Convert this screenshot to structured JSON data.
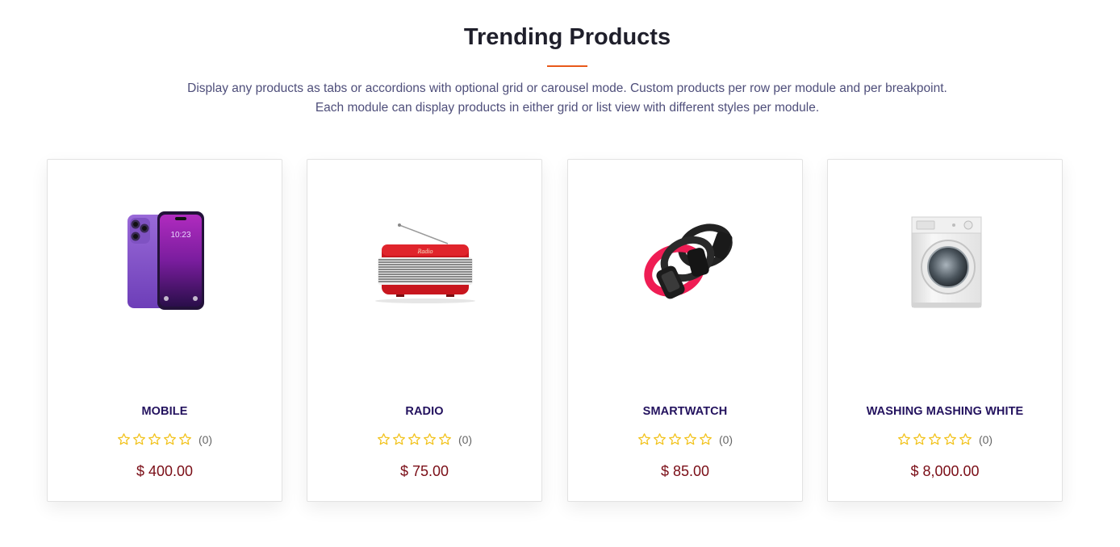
{
  "section": {
    "title": "Trending Products",
    "description_line1": "Display any products as tabs or accordions with optional grid or carousel mode. Custom products per row per module and per breakpoint.",
    "description_line2": "Each module can display products in either grid or list view with different styles per module."
  },
  "colors": {
    "accent": "#e8591a",
    "product_name": "#23125e",
    "price": "#7a0d16",
    "star": "#f2c21a"
  },
  "products": [
    {
      "name": "MOBILE",
      "image_icon": "smartphone-image",
      "rating_stars": 0,
      "reviews": "(0)",
      "price": "$ 400.00"
    },
    {
      "name": "RADIO",
      "image_icon": "radio-image",
      "rating_stars": 0,
      "reviews": "(0)",
      "price": "$ 75.00"
    },
    {
      "name": "SMARTWATCH",
      "image_icon": "smartwatch-image",
      "rating_stars": 0,
      "reviews": "(0)",
      "price": "$ 85.00"
    },
    {
      "name": "WASHING MASHING WHITE",
      "image_icon": "washing-machine-image",
      "rating_stars": 0,
      "reviews": "(0)",
      "price": "$ 8,000.00"
    }
  ]
}
